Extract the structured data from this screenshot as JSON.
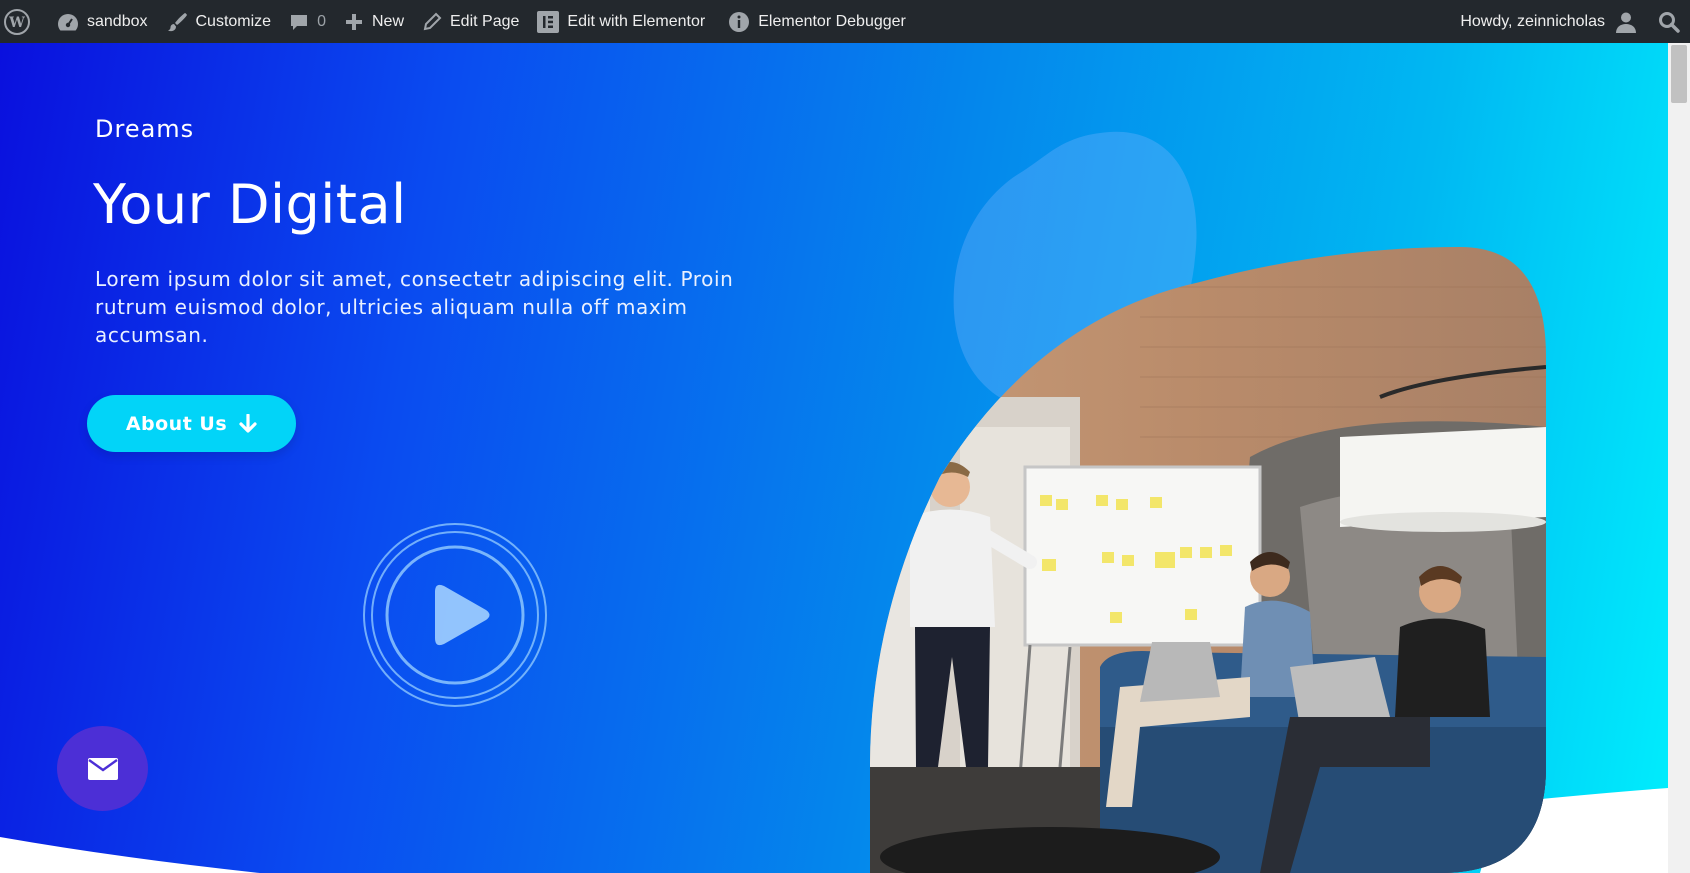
{
  "adminbar": {
    "site_name": "sandbox",
    "customize": "Customize",
    "comments_count": "0",
    "new": "New",
    "edit_page": "Edit Page",
    "edit_elementor": "Edit with Elementor",
    "debugger": "Elementor Debugger",
    "howdy": "Howdy, zeinnicholas"
  },
  "hero": {
    "subtitle": "Dreams",
    "title": "Your Digital",
    "description": "Lorem ipsum dolor sit amet, consectetr adipiscing elit. Proin rutrum euismod dolor, ultricies aliquam nulla off  maxim accumsan.",
    "button_label": "About Us"
  },
  "colors": {
    "adminbar_bg": "#23282d",
    "gradient_start": "#0a10de",
    "gradient_end": "#00eefd",
    "button_bg": "#02d4f8",
    "mail_button_bg": "#4c2fd6"
  },
  "icons": {
    "wp_logo": "wordpress-logo-icon",
    "dashboard": "dashboard-icon",
    "customize": "brush-icon",
    "comments": "comment-icon",
    "new": "plus-icon",
    "edit": "pencil-icon",
    "elementor": "elementor-icon",
    "debugger": "info-icon",
    "user": "user-icon",
    "search": "search-icon",
    "arrow": "arrow-down-icon",
    "play": "play-icon",
    "mail": "mail-icon"
  }
}
